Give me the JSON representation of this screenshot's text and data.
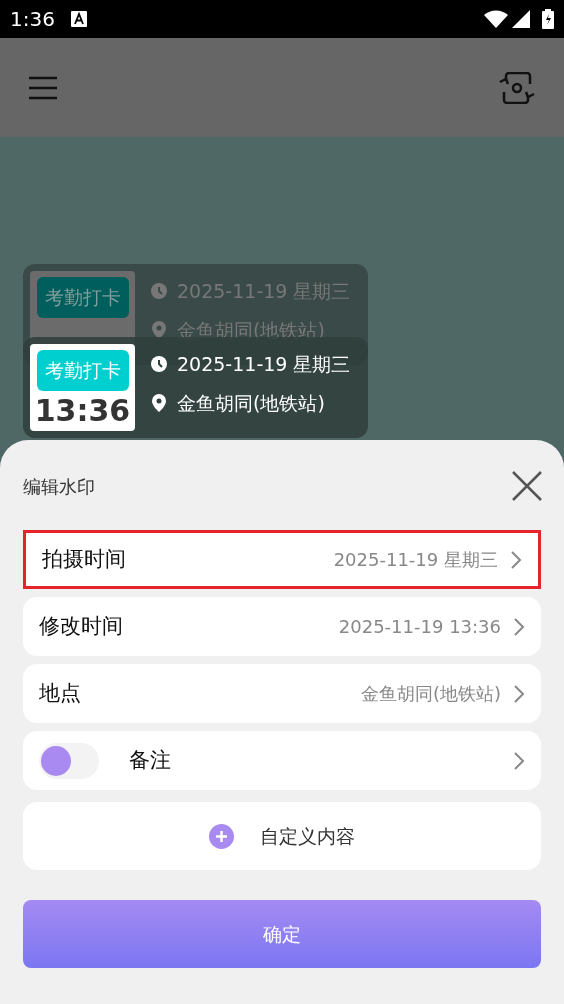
{
  "status_bar": {
    "time": "1:36"
  },
  "watermark_ghost": {
    "badge": "考勤打卡",
    "date": "2025-11-19 星期三",
    "location": "金鱼胡同(地铁站)"
  },
  "watermark": {
    "badge": "考勤打卡",
    "time": "13:36",
    "date": "2025-11-19 星期三",
    "location": "金鱼胡同(地铁站)"
  },
  "sheet": {
    "title": "编辑水印",
    "rows": [
      {
        "kind": "field",
        "label": "拍摄时间",
        "value": "2025-11-19 星期三",
        "highlighted": true
      },
      {
        "kind": "field",
        "label": "修改时间",
        "value": "2025-11-19 13:36",
        "highlighted": false
      },
      {
        "kind": "field",
        "label": "地点",
        "value": "金鱼胡同(地铁站)",
        "highlighted": false
      },
      {
        "kind": "toggle",
        "label": "备注",
        "on": false,
        "highlighted": false
      }
    ],
    "add_button": "自定义内容",
    "confirm_button": "确定"
  }
}
